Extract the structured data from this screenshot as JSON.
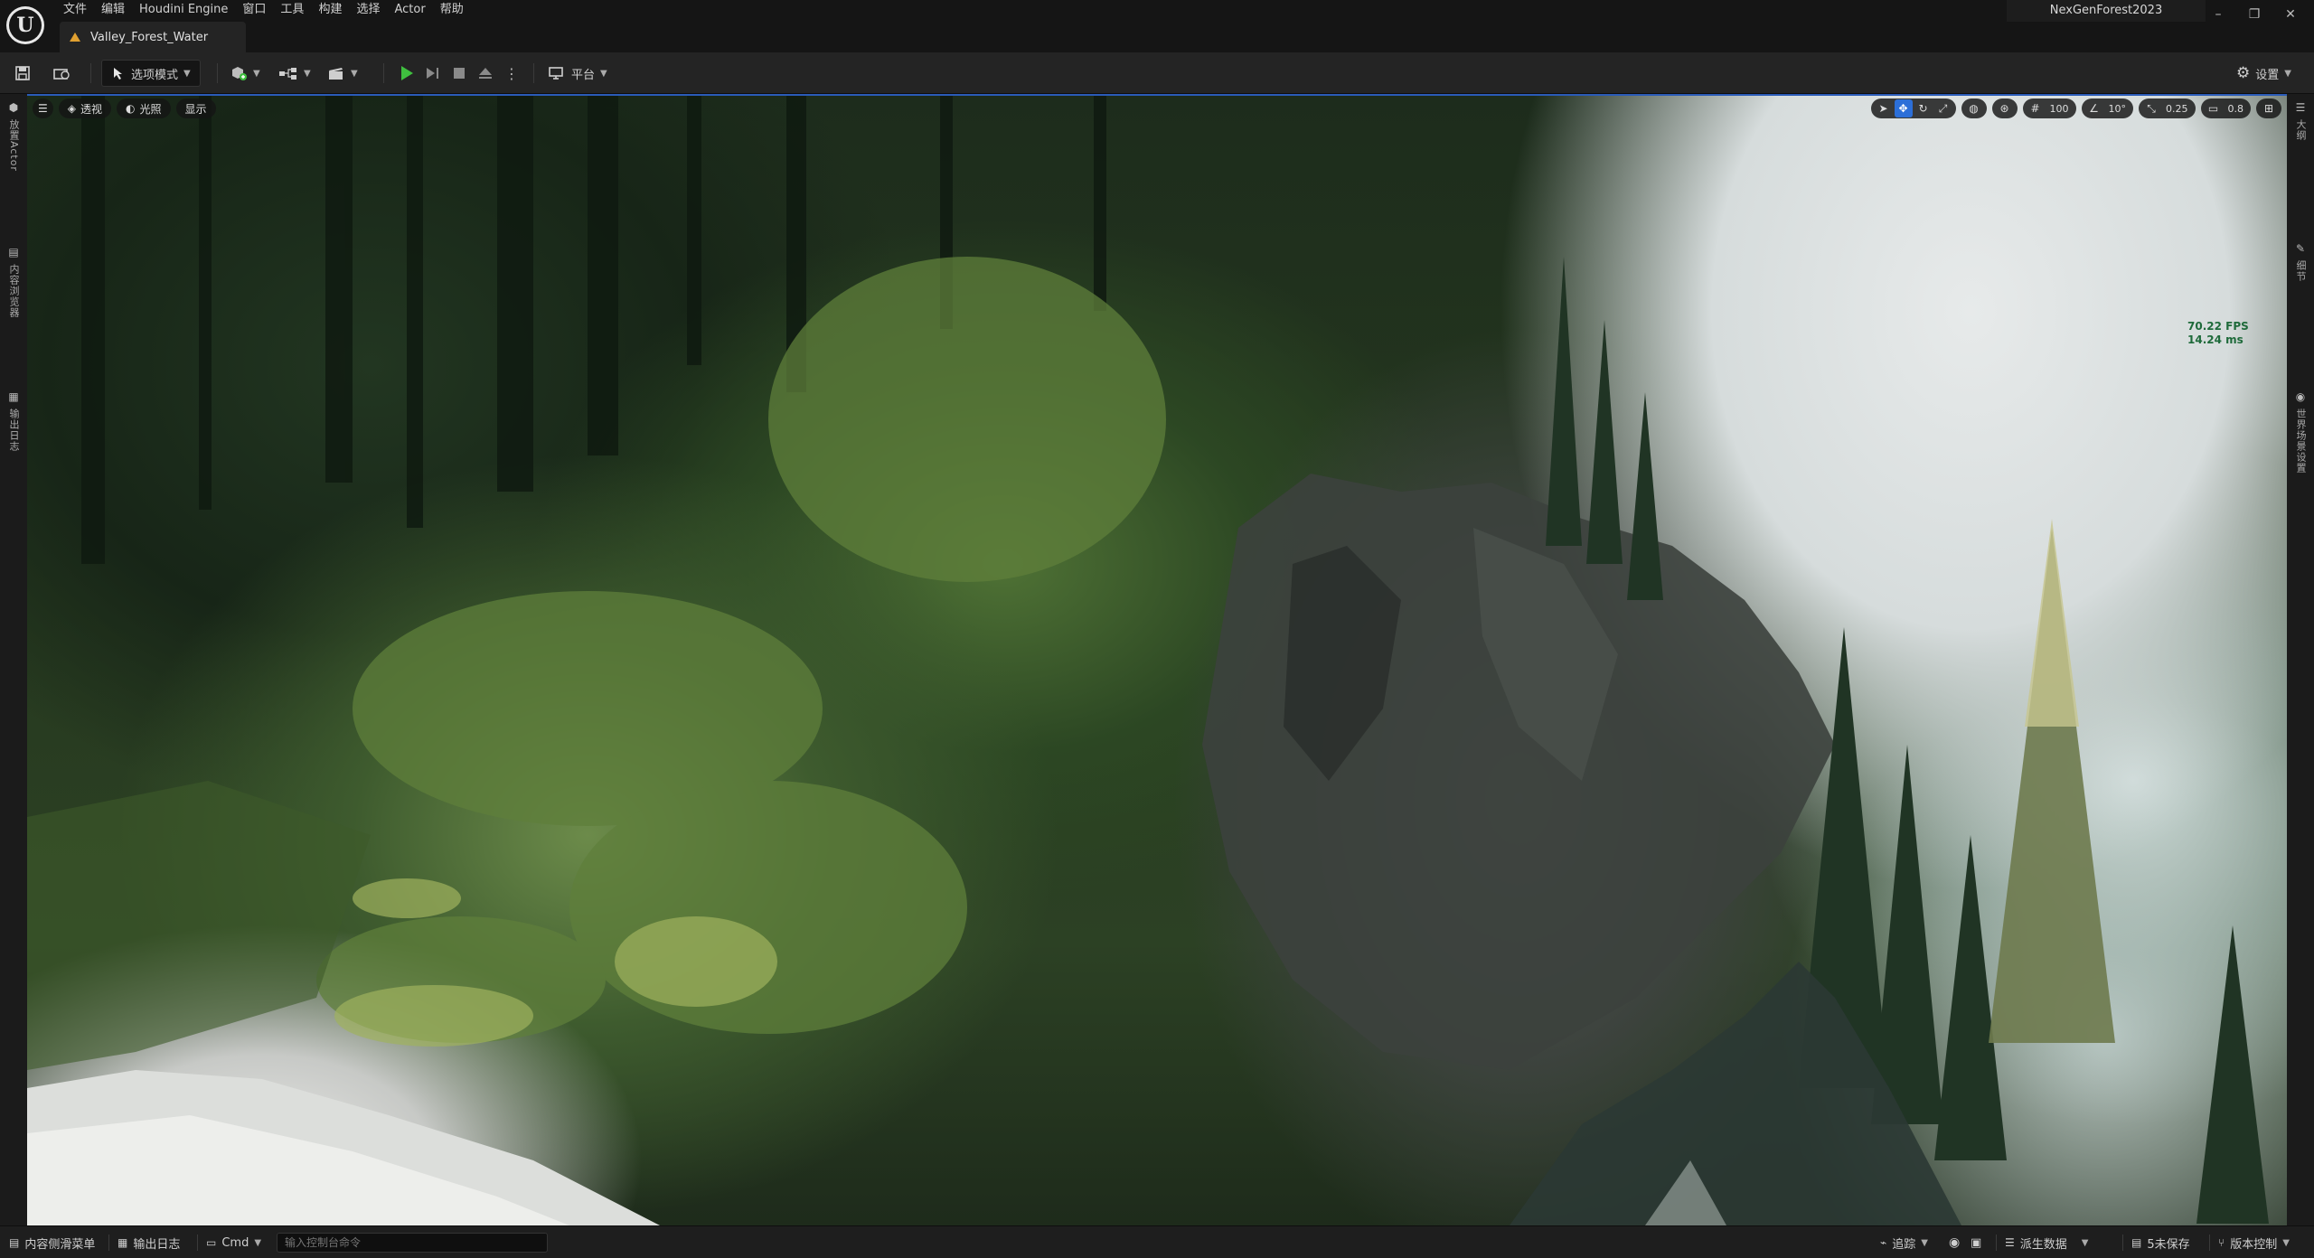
{
  "window": {
    "menu": [
      "文件",
      "编辑",
      "Houdini Engine",
      "窗口",
      "工具",
      "构建",
      "选择",
      "Actor",
      "帮助"
    ],
    "document_tab": "Valley_Forest_Water",
    "project_name": "NexGenForest2023"
  },
  "toolbar": {
    "mode_label": "选项模式",
    "platform_label": "平台",
    "settings_label": "设置"
  },
  "left_panel": {
    "tabs": [
      "放置Actor",
      "内容浏览器",
      "输出日志"
    ]
  },
  "right_panel": {
    "tabs": [
      "大纲",
      "细节",
      "世界场景设置"
    ]
  },
  "viewport": {
    "perspective_label": "透视",
    "lighting_label": "光照",
    "show_label": "显示",
    "grid_size": "100",
    "rotation_snap": "10°",
    "scale_snap": "0.25",
    "camera_speed": "0.8",
    "fps": "70.22 FPS",
    "frame_time": "14.24 ms"
  },
  "statusbar": {
    "content_drawer": "内容侧滑菜单",
    "output_log": "输出日志",
    "cmd_label": "Cmd",
    "console_placeholder": "输入控制台命令",
    "trace_label": "追踪",
    "derived_data": "派生数据",
    "unsaved": "5未保存",
    "source_control": "版本控制"
  },
  "colors": {
    "accent": "#2c6fd8",
    "play_green": "#3fbf3f",
    "fps_text": "#1e6a3a"
  }
}
